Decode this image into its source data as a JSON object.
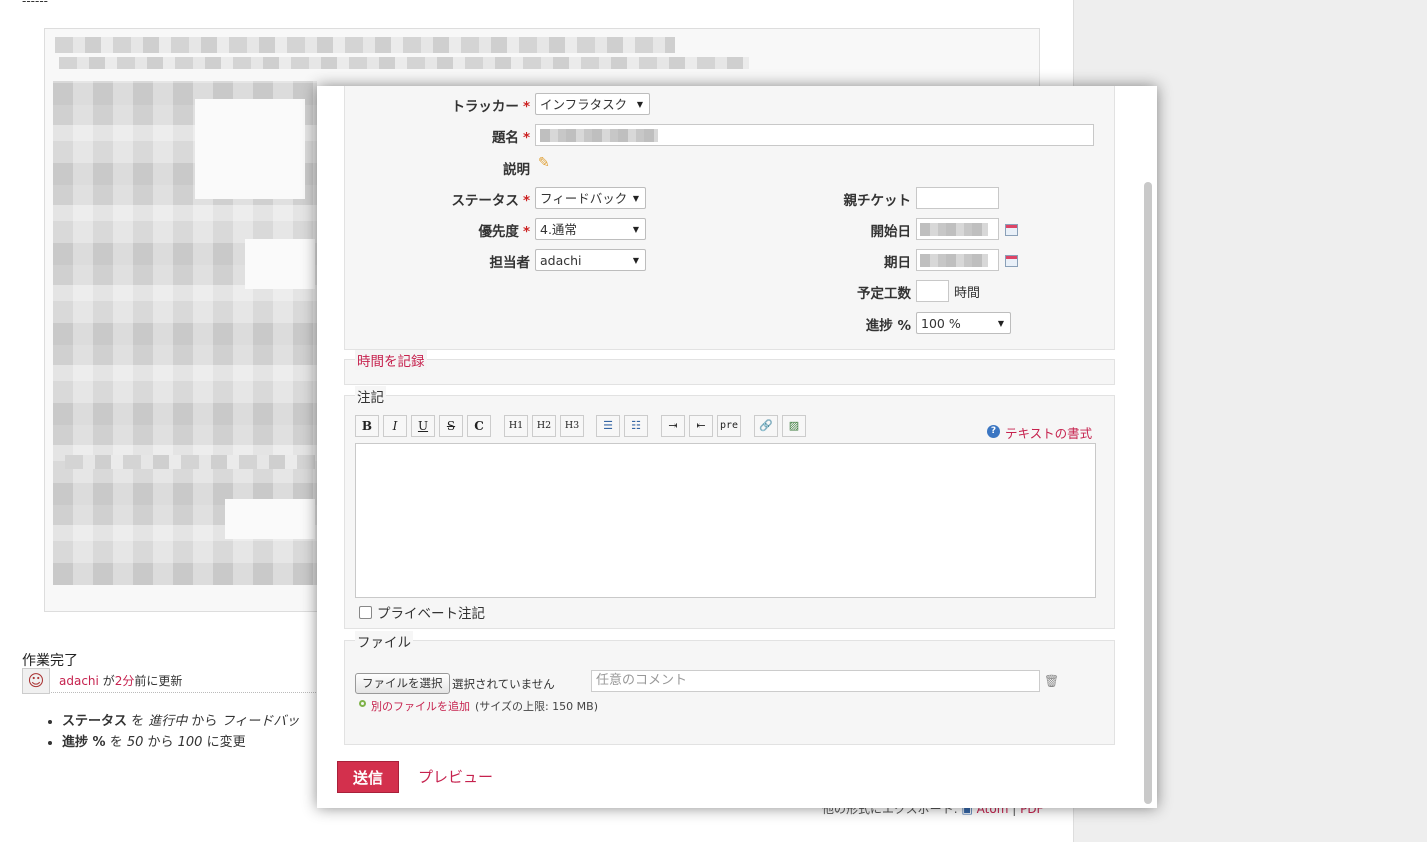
{
  "background": {
    "dashes": "------",
    "journal_note": {
      "title": "作業完了",
      "author": "adachi",
      "author_suffix": " が",
      "time_link": "2分",
      "time_suffix": "前に更新",
      "changes": [
        {
          "field": "ステータス",
          "from": "進行中",
          "to": "フィードバッ"
        },
        {
          "field": "進捗 %",
          "from": "50",
          "to": "100",
          "suffix": "に変更"
        }
      ],
      "change_words": {
        "wo": " を ",
        "kara": " から "
      }
    },
    "export": {
      "label": "他の形式にエクスポート: ",
      "atom": "Atom",
      "sep": " | ",
      "pdf": "PDF"
    }
  },
  "form": {
    "tracker": {
      "label": "トラッカー",
      "value": "インフラタスク"
    },
    "subject": {
      "label": "題名"
    },
    "description": {
      "label": "説明"
    },
    "status": {
      "label": "ステータス",
      "value": "フィードバック"
    },
    "priority": {
      "label": "優先度",
      "value": "4.通常"
    },
    "assignee": {
      "label": "担当者",
      "value": "adachi"
    },
    "parent": {
      "label": "親チケット",
      "value": ""
    },
    "start_date": {
      "label": "開始日"
    },
    "due_date": {
      "label": "期日"
    },
    "estimated": {
      "label": "予定工数",
      "value": "",
      "unit": "時間"
    },
    "done_ratio": {
      "label": "進捗 %",
      "value": "100 %"
    },
    "required_mark": "*"
  },
  "time_log": {
    "legend": "時間を記録"
  },
  "notes": {
    "legend": "注記",
    "toolbar": [
      "B",
      "I",
      "U",
      "S",
      "C",
      "H1",
      "H2",
      "H3",
      "ul",
      "ol",
      "indent",
      "outdent",
      "pre",
      "link",
      "image"
    ],
    "pre_label": "pre",
    "format_help": "テキストの書式",
    "private_label": "プライベート注記"
  },
  "files": {
    "legend": "ファイル",
    "choose_button": "ファイルを選択",
    "no_file": "選択されていません",
    "comment_placeholder": "任意のコメント",
    "add_another": "別のファイルを追加",
    "size_limit": "(サイズの上限: 150 MB)"
  },
  "actions": {
    "submit": "送信",
    "preview": "プレビュー"
  },
  "colors": {
    "accent": "#c6224e",
    "submit_bg": "#d3304d"
  }
}
